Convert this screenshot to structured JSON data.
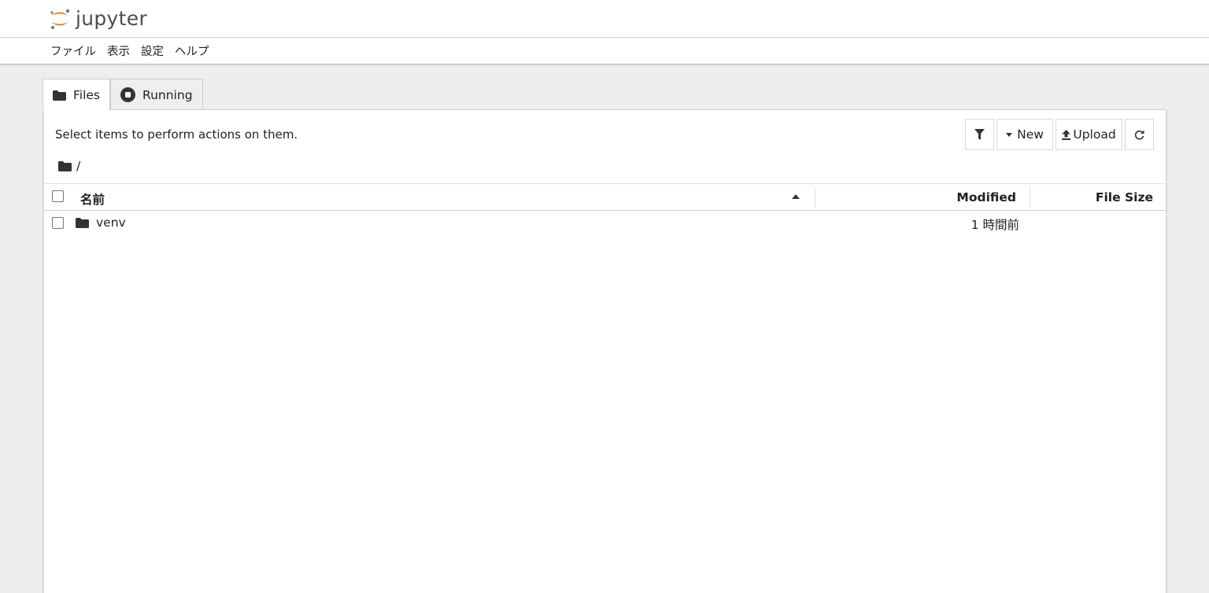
{
  "header": {
    "logo_text": "jupyter",
    "logo_accent": "#f37726"
  },
  "menubar": {
    "items": [
      {
        "label": "ファイル"
      },
      {
        "label": "表示"
      },
      {
        "label": "設定"
      },
      {
        "label": "ヘルプ"
      }
    ]
  },
  "tabs": [
    {
      "label": "Files",
      "icon": "folder-icon",
      "active": true
    },
    {
      "label": "Running",
      "icon": "stop-circle-icon",
      "active": false
    }
  ],
  "filebrowser": {
    "hint": "Select items to perform actions on them.",
    "toolbar": {
      "filter_icon": "filter-icon",
      "new_label": "New",
      "upload_label": "Upload",
      "refresh_icon": "refresh-icon"
    },
    "breadcrumb": "/",
    "columns": {
      "name": "名前",
      "modified": "Modified",
      "size": "File Size"
    },
    "sort": {
      "column": "name",
      "direction": "ascending"
    },
    "rows": [
      {
        "name": "venv",
        "type": "directory",
        "modified": "1 時間前",
        "size": ""
      }
    ]
  }
}
